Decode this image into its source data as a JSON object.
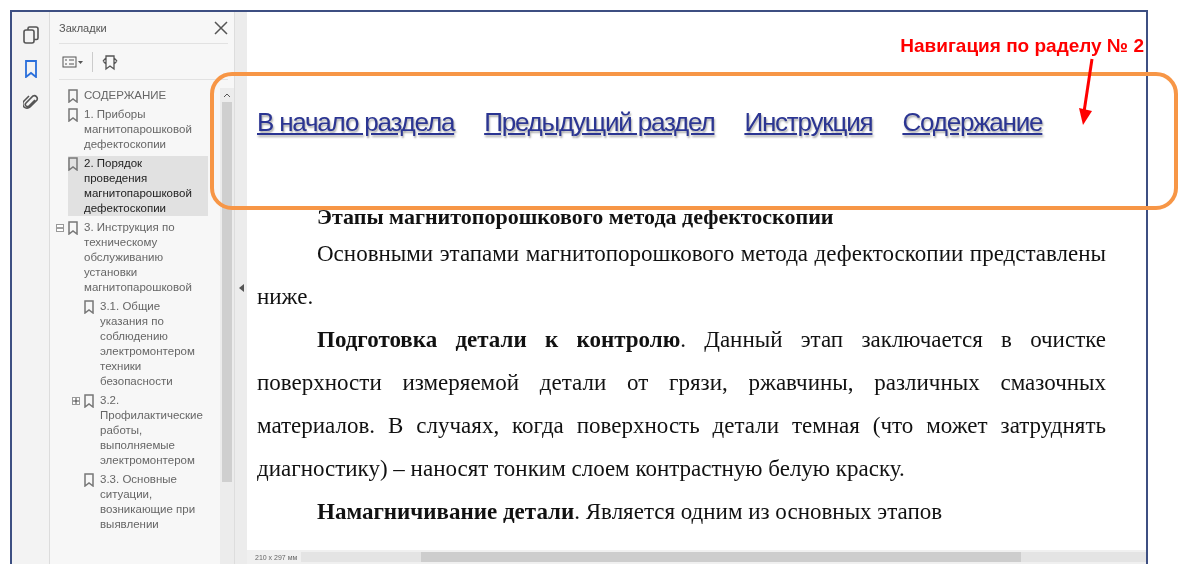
{
  "sidebar_tools": [
    {
      "kind": "pages",
      "selected": false
    },
    {
      "kind": "bookmarks",
      "selected": true
    },
    {
      "kind": "attachments",
      "selected": false
    }
  ],
  "bookmarks_panel": {
    "title": "Закладки",
    "items": [
      {
        "label": "СОДЕРЖАНИЕ",
        "selected": false
      },
      {
        "label": "1. Приборы магнитопарошковой дефектоскопии",
        "selected": false
      },
      {
        "label": "2. Порядок проведения магнитопарошковой дефектоскопии",
        "selected": true
      },
      {
        "label": "3. Инструкция по техническому обслуживанию установки магнитопарошковой",
        "selected": false,
        "expanded": true,
        "children": [
          {
            "label": "3.1. Общие указания по соблюдению электромонтером техники безопасности",
            "selected": false
          },
          {
            "label": "3.2. Профилактические работы, выполняемые электромонтером",
            "selected": false,
            "expanded": false
          },
          {
            "label": "3.3. Основные ситуации, возникающие при выявлении",
            "selected": false
          }
        ]
      }
    ]
  },
  "document": {
    "nav_links": [
      "В начало раздела",
      "Предыдущий раздел",
      "Инструкция",
      "Содержание"
    ],
    "heading": "Этапы магнитопорошкового метода дефектоскопии",
    "paragraphs": [
      "Основными этапами магнитопорошкового метода дефектоскопии представлены ниже.",
      "**Подготовка детали к контролю**. Данный этап заключается в очистке поверхности измеряемой детали от грязи, ржавчины, различных смазочных материалов. В случаях, когда поверхность детали темная (что может затруднять диагностику) – наносят тонким слоем контрастную белую краску.",
      "**Намагничивание детали**. Является одним из основных этапов"
    ],
    "page_size": "210 x 297 мм"
  },
  "annotation": {
    "label": "Навигация по раделу № 2"
  }
}
